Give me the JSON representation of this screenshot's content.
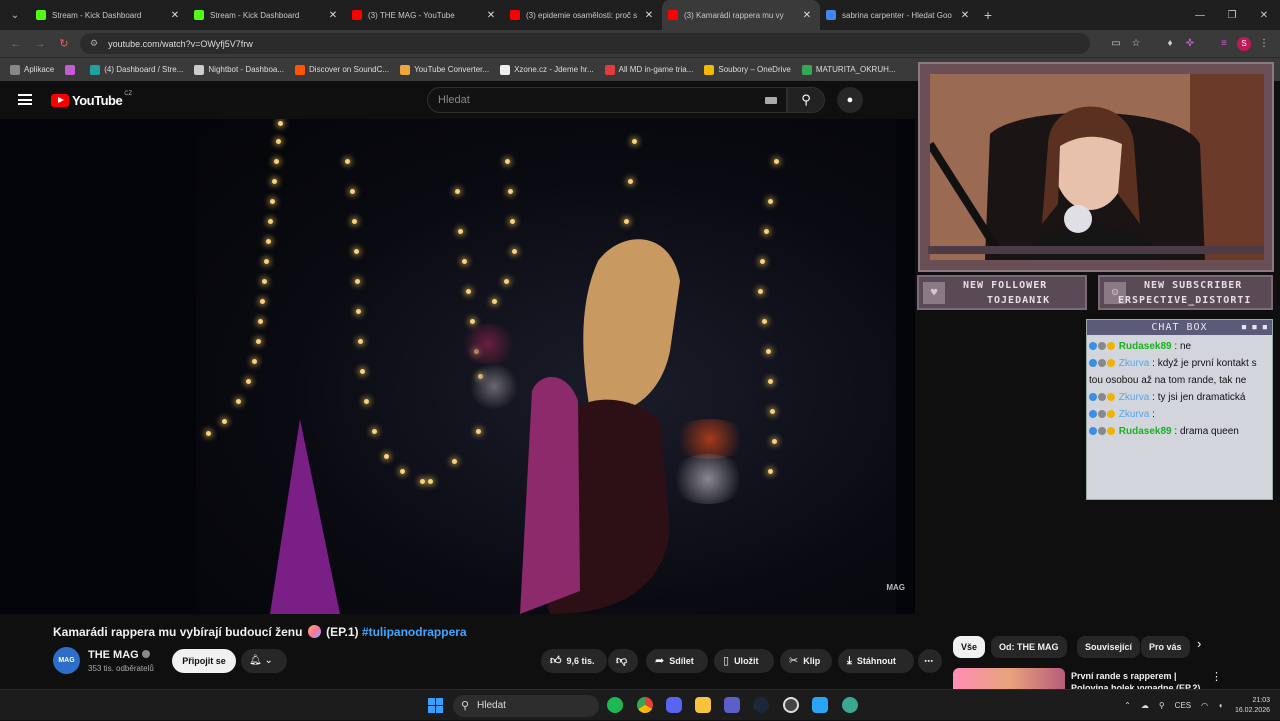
{
  "browser": {
    "tabs": [
      {
        "label": "Stream - Kick Dashboard",
        "color": "#53fc18",
        "active": false
      },
      {
        "label": "Stream - Kick Dashboard",
        "color": "#53fc18",
        "active": false
      },
      {
        "label": "(3) THE MAG - YouTube",
        "color": "#ff0000",
        "active": false
      },
      {
        "label": "(3) epidemie osamělosti: proč s",
        "color": "#ff0000",
        "active": false
      },
      {
        "label": "(3) Kamarádi rappera mu vy",
        "color": "#ff0000",
        "active": true
      },
      {
        "label": "sabrina carpenter - Hledat Goo",
        "color": "#4285f4",
        "active": false
      }
    ],
    "url": "youtube.com/watch?v=OWyfj5V7frw",
    "bookmarks": [
      {
        "label": "Aplikace",
        "color": "#888888"
      },
      {
        "label": "",
        "color": "#c45cd6"
      },
      {
        "label": "(4) Dashboard / Stre...",
        "color": "#1fa3a0"
      },
      {
        "label": "Nightbot - Dashboa...",
        "color": "#cccccc"
      },
      {
        "label": "Discover on SoundC...",
        "color": "#ff5500"
      },
      {
        "label": "YouTube Converter...",
        "color": "#f2a53c"
      },
      {
        "label": "Xzone.cz - Jdeme hr...",
        "color": "#eeeeee"
      },
      {
        "label": "All MD in-game tria...",
        "color": "#e23b3b"
      },
      {
        "label": "Soubory – OneDrive",
        "color": "#f3b900"
      },
      {
        "label": "MATURITA_OKRUH...",
        "color": "#34a853"
      }
    ]
  },
  "youtube": {
    "logo": "YouTube",
    "country": "CZ",
    "search_placeholder": "Hledat",
    "watermark": "MAG",
    "video_title": "Kamarádi rappera mu vybírají budoucí ženu",
    "video_title_suffix": "(EP.1)",
    "hashtag": "#tulipanodrappera",
    "channel": {
      "name": "THE MAG",
      "subs": "353 tis. odběratelů",
      "avatar": "MAG"
    },
    "join_label": "Připojit se",
    "actions": {
      "likes": "9,6 tis.",
      "share": "Sdílet",
      "save": "Uložit",
      "clip": "Klip",
      "download": "Stáhnout"
    },
    "chips": [
      "Vše",
      "Od: THE MAG",
      "Související",
      "Pro vás"
    ],
    "rec_title": "První rande s rapperem | Polovina holek vypadne (EP.2)"
  },
  "stream_overlay": {
    "follower_label": "NEW FOLLOWER",
    "follower_name": "TOJEDANIK",
    "subscriber_label": "NEW SUBSCRIBER",
    "subscriber_name": "ERSPECTIVE_DISTORTI",
    "chat_title": "CHAT BOX",
    "messages": [
      {
        "user": "Rudasek89",
        "user_color": "green",
        "text": "ne"
      },
      {
        "user": "Zkurva",
        "user_color": "blue",
        "text": "když je první kontakt s tou osobou až na tom rande, tak ne"
      },
      {
        "user": "Zkurva",
        "user_color": "blue",
        "text": "ty jsi jen dramatická"
      },
      {
        "user": "Zkurva",
        "user_color": "blue",
        "text": ""
      },
      {
        "user": "Rudasek89",
        "user_color": "green",
        "text": "drama queen"
      }
    ]
  },
  "taskbar": {
    "search": "Hledat",
    "lang": "CES",
    "time": "21:03",
    "date": "16.02.2026"
  }
}
